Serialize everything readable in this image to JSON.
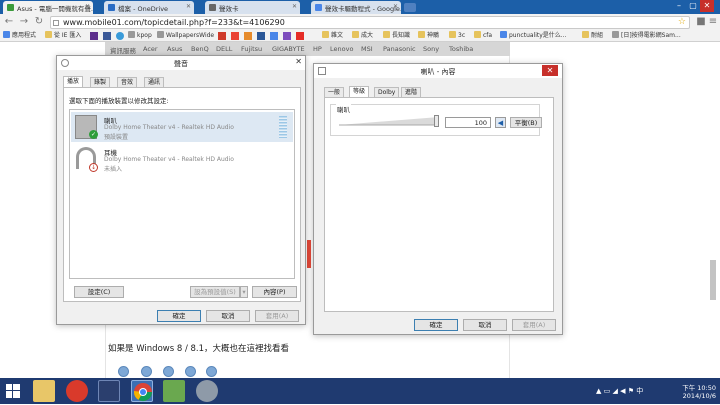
{
  "browser": {
    "tabs": [
      {
        "title": "Asus - 電腦一開機就有聲…",
        "active": true,
        "color": "#3b9b3b"
      },
      {
        "title": "檔案 - OneDrive",
        "active": false,
        "color": "#2a6cc4"
      },
      {
        "title": "聲效卡",
        "active": false,
        "color": "#666666"
      },
      {
        "title": "聲效卡驅動程式 - Google…",
        "active": false,
        "color": "#4a86e8"
      }
    ],
    "url": "www.mobile01.com/topicdetail.php?f=233&t=4106290",
    "bookmarks": [
      "應用程式",
      "從 IE 匯入",
      "kpop",
      "WallpapersWide",
      "雜文",
      "成大",
      "長知識",
      "神鵰",
      "3c",
      "cfa",
      "punctuality是什么...",
      "耐組",
      "[日]按得電影網Sam..."
    ]
  },
  "site_nav": [
    "資訊服務",
    "Acer",
    "Asus",
    "BenQ",
    "DELL",
    "Fujitsu",
    "GIGABYTE",
    "HP",
    "Lenovo",
    "MSI",
    "Panasonic",
    "Sony",
    "Toshiba"
  ],
  "article_text": "如果是 Windows 8 / 8.1，大概也在這裡找看看",
  "sound_dialog": {
    "title": "聲音",
    "tabs": [
      "播放",
      "錄製",
      "音效",
      "通訊"
    ],
    "instruction": "選取下面的播放裝置以修改其設定:",
    "devices": [
      {
        "name": "喇叭",
        "driver": "Dolby Home Theater v4 - Realtek HD Audio",
        "status": "預設裝置"
      },
      {
        "name": "耳機",
        "driver": "Dolby Home Theater v4 - Realtek HD Audio",
        "status": "未插入"
      }
    ],
    "configure_label": "設定(C)",
    "set_default_label": "設為預設值(S)",
    "properties_label": "內容(P)",
    "ok": "確定",
    "cancel": "取消",
    "apply": "套用(A)"
  },
  "props_dialog": {
    "title": "喇叭 - 內容",
    "tabs": [
      "一般",
      "等級",
      "Dolby",
      "進階"
    ],
    "level_label": "喇叭",
    "level_value": "100",
    "level_fraction": 1.0,
    "balance_label": "平衡(B)",
    "ok": "確定",
    "cancel": "取消",
    "apply": "套用(A)"
  },
  "taskbar": {
    "time": "下午 10:50",
    "date": "2014/10/6"
  }
}
